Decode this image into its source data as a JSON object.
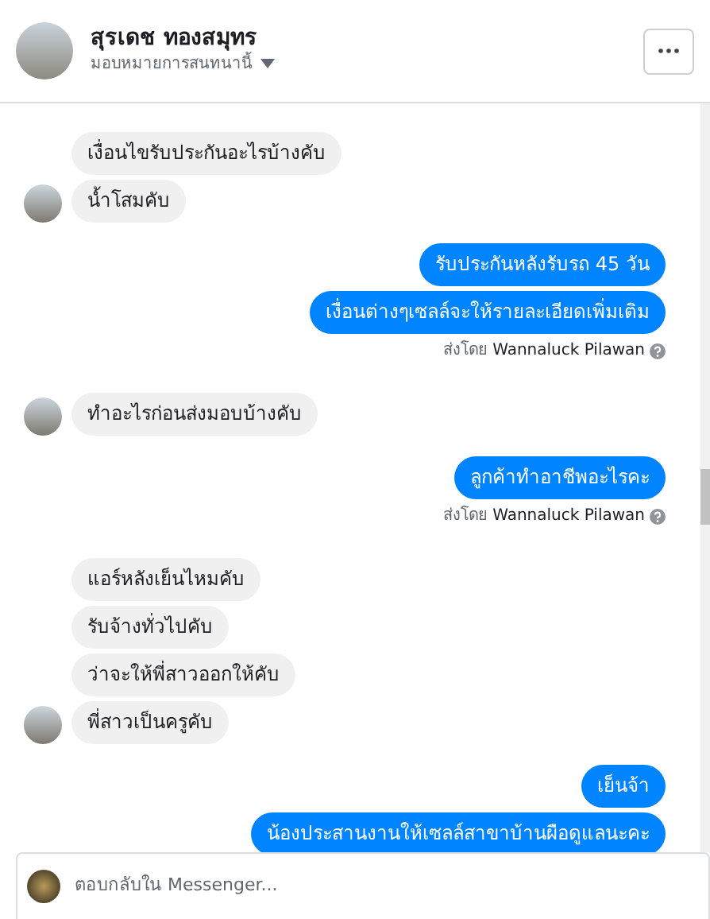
{
  "header": {
    "name": "สุรเดช ทองสมุทร",
    "subtitle": "มอบหมายการสนทนานี้"
  },
  "messages": [
    {
      "kind": "incoming",
      "text": "เงื่อนไขรับประกันอะไรบ้างคับ",
      "avatar": false
    },
    {
      "kind": "incoming",
      "text": "น้ำโสมคับ",
      "avatar": true
    },
    {
      "kind": "outgoing",
      "text": "รับประกันหลังรับรถ 45 วัน"
    },
    {
      "kind": "outgoing",
      "text": "เงื่อนต่างๆเซลล์จะให้รายละเอียดเพิ่มเติม"
    },
    {
      "kind": "note",
      "text": "ส่งโดย **Wannaluck Pilawan**"
    },
    {
      "kind": "incoming",
      "text": "ทำอะไรก่อนส่งมอบบ้างคับ",
      "avatar": true
    },
    {
      "kind": "outgoing",
      "text": "ลูกค้าทำอาชีพอะไรคะ"
    },
    {
      "kind": "note",
      "text": "ส่งโดย **Wannaluck Pilawan**"
    },
    {
      "kind": "incoming",
      "text": "แอร์หลังเย็นไหมคับ",
      "avatar": false
    },
    {
      "kind": "incoming",
      "text": "รับจ้างทั่วไปคับ",
      "avatar": false
    },
    {
      "kind": "incoming",
      "text": "ว่าจะให้พี่สาวออกให้คับ",
      "avatar": false
    },
    {
      "kind": "incoming",
      "text": "พี่สาวเป็นครูคับ",
      "avatar": true
    },
    {
      "kind": "outgoing",
      "text": "เย็นจ้า"
    },
    {
      "kind": "outgoing",
      "text": "น้องประสานงานให้เซลล์สาขาบ้านผือดูแลนะคะ"
    }
  ],
  "composer": {
    "placeholder": "ตอบกลับใน Messenger..."
  }
}
